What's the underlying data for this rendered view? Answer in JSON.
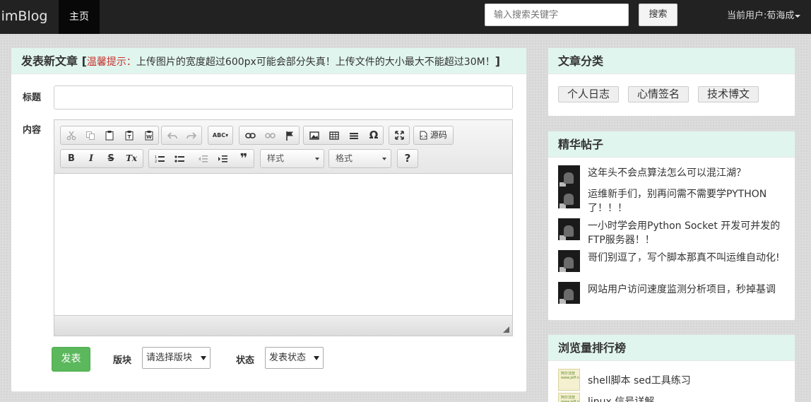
{
  "nav": {
    "brand": "JimBlog",
    "home": "主页",
    "search_placeholder": "输入搜索关键字",
    "search_button": "搜索",
    "current_user": "当前用户:荀海成"
  },
  "editor_panel": {
    "title": "发表新文章",
    "notice_open": "[",
    "notice_label": "温馨提示：",
    "notice_text": "上传图片的宽度超过600px可能会部分失真！上传文件的大小最大不能超过30M！",
    "notice_close": "]",
    "title_label": "标题",
    "title_value": "",
    "content_label": "内容",
    "toolbar": {
      "source_label": "源码",
      "style_combo": "样式",
      "format_combo": "格式",
      "help": "?",
      "bold": "B",
      "italic": "I",
      "strike": "S",
      "remove_format": "Tx",
      "omega": "Ω",
      "quote": "❞",
      "spell": "ABC"
    },
    "publish_button": "发表",
    "section_label": "版块",
    "section_select": "请选择版块",
    "status_label": "状态",
    "status_select": "发表状态"
  },
  "categories": {
    "title": "文章分类",
    "tags": [
      "个人日志",
      "心情签名",
      "技术博文"
    ]
  },
  "featured": {
    "title": "精华帖子",
    "posts": [
      "这年头不会点算法怎么可以混江湖？",
      "运维新手们，别再问需不需要学PYTHON了！！！",
      "一小时学会用Python Socket 开发可并发的FTP服务器！！",
      "哥们别逗了，写个脚本那真不叫运维自动化!",
      "网站用户访问速度监测分析项目，秒掉基调"
    ]
  },
  "ranking": {
    "title": "浏览量排行榜",
    "items": [
      "shell脚本 sed工具练习",
      "linux 信号详解"
    ],
    "thumb_text": "阿尔法技 www.jeff.net"
  },
  "colors": {
    "navbar": "#222222",
    "panel_header": "#e0f5ee",
    "publish": "#5cb85c",
    "notice_red": "#c9302c"
  }
}
